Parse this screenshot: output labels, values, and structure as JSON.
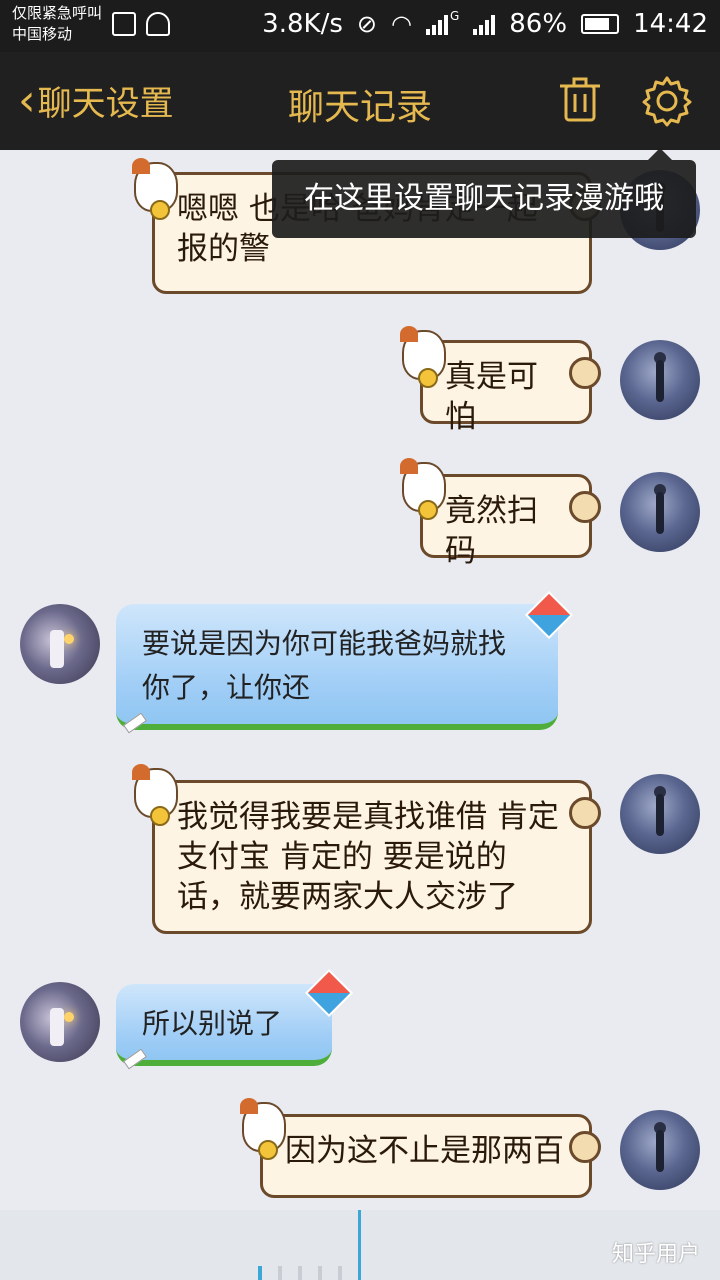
{
  "status_bar": {
    "emergency_text": "仅限紧急呼叫",
    "carrier": "中国移动",
    "net_speed": "3.8K/s",
    "battery": "86%",
    "time": "14:42",
    "network_type": "G",
    "icons": [
      "image-icon",
      "usb-icon",
      "mute-icon",
      "wifi-icon",
      "signal-icon",
      "battery-icon"
    ]
  },
  "nav": {
    "back_label": "聊天设置",
    "title": "聊天记录",
    "trash_icon": "trash-icon",
    "gear_icon": "gear-icon"
  },
  "tooltip": "在这里设置聊天记录漫游哦",
  "messages": [
    {
      "side": "right",
      "text": "嗯嗯 也是哈 爸妈肯定一起报的警"
    },
    {
      "side": "right",
      "text": "真是可怕"
    },
    {
      "side": "right",
      "text": "竟然扫码"
    },
    {
      "side": "left",
      "text": "要说是因为你可能我爸妈就找你了，让你还"
    },
    {
      "side": "right",
      "text": "我觉得我要是真找谁借 肯定支付宝 肯定的 要是说的话，就要两家大人交涉了"
    },
    {
      "side": "left",
      "text": "所以别说了"
    },
    {
      "side": "right",
      "text": "因为这不止是那两百"
    }
  ],
  "watermark": "知乎用户",
  "colors": {
    "nav_bg": "#202020",
    "nav_accent": "#e5b94f",
    "chat_bg": "#e9ebf0",
    "cursor": "#3aa7d6"
  }
}
